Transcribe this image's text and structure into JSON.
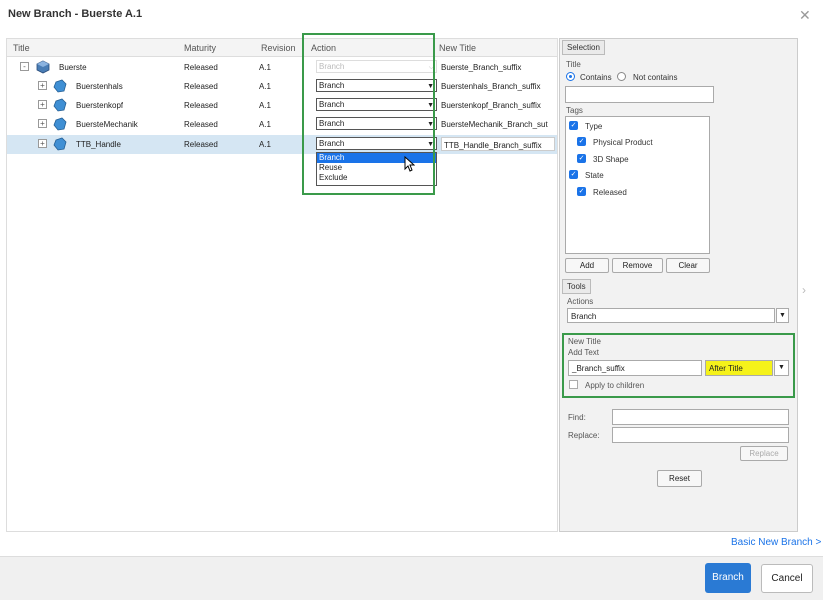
{
  "dialog": {
    "title": "New Branch - Buerste A.1"
  },
  "table": {
    "headers": {
      "title": "Title",
      "maturity": "Maturity",
      "revision": "Revision",
      "action": "Action",
      "new_title": "New Title"
    },
    "rows": [
      {
        "expander": "-",
        "title": "Buerste",
        "maturity": "Released",
        "revision": "A.1",
        "action": "Branch",
        "new_title": "Buerste_Branch_suffix"
      },
      {
        "expander": "+",
        "title": "Buerstenhals",
        "maturity": "Released",
        "revision": "A.1",
        "action": "Branch",
        "new_title": "Buerstenhals_Branch_suffix"
      },
      {
        "expander": "+",
        "title": "Buerstenkopf",
        "maturity": "Released",
        "revision": "A.1",
        "action": "Branch",
        "new_title": "Buerstenkopf_Branch_suffix"
      },
      {
        "expander": "+",
        "title": "BuersteMechanik",
        "maturity": "Released",
        "revision": "A.1",
        "action": "Branch",
        "new_title": "BuersteMechanik_Branch_sut"
      },
      {
        "expander": "+",
        "title": "TTB_Handle",
        "maturity": "Released",
        "revision": "A.1",
        "action": "Branch",
        "new_title": "TTB_Handle_Branch_suffix"
      }
    ],
    "dropdown_options": [
      "Branch",
      "Reuse",
      "Exclude"
    ]
  },
  "panel": {
    "selection_tab": "Selection",
    "title_label": "Title",
    "contains": "Contains",
    "not_contains": "Not contains",
    "tags_label": "Tags",
    "tags": [
      {
        "label": "Type"
      },
      {
        "label": "Physical Product"
      },
      {
        "label": "3D Shape"
      },
      {
        "label": "State"
      },
      {
        "label": "Released"
      }
    ],
    "add": "Add",
    "remove": "Remove",
    "clear": "Clear",
    "tools_tab": "Tools",
    "actions_label": "Actions",
    "actions_value": "Branch",
    "new_title_label": "New Title",
    "add_text_label": "Add Text",
    "add_text_value": "_Branch_suffix",
    "position_value": "After Title",
    "apply_children": "Apply to children",
    "find": "Find:",
    "replace": "Replace:",
    "replace_btn": "Replace",
    "reset": "Reset"
  },
  "footer": {
    "basic_link": "Basic New Branch >",
    "primary": "Branch",
    "cancel": "Cancel"
  },
  "colors": {
    "accent": "#2a7ad4",
    "highlight": "#f5f21a",
    "frame": "#3a9a4a"
  }
}
